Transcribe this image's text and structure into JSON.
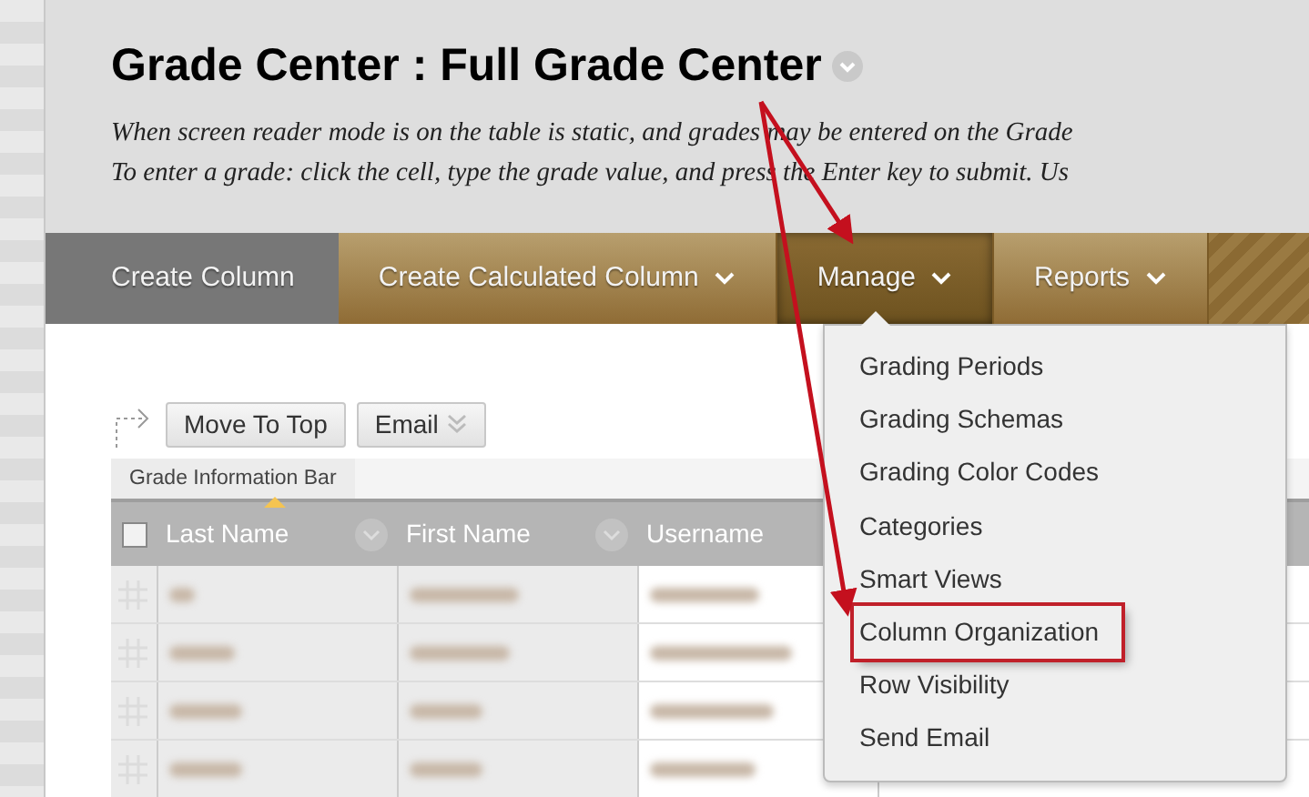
{
  "page_title": "Grade Center : Full Grade Center",
  "description": [
    "When screen reader mode is on the table is static, and grades may be entered on the Grade",
    "To enter a grade: click the cell, type the grade value, and press the Enter key to submit. Us"
  ],
  "nav": [
    {
      "label": "Create Column",
      "kind": "plain",
      "selected": false
    },
    {
      "label": "Create Calculated Column",
      "kind": "menu",
      "selected": false
    },
    {
      "label": "Manage",
      "kind": "menu",
      "selected": true
    },
    {
      "label": "Reports",
      "kind": "menu",
      "selected": false
    }
  ],
  "toolbar": {
    "buttons": [
      {
        "label": "Move To Top",
        "kind": "plain"
      },
      {
        "label": "Email",
        "kind": "menu"
      }
    ],
    "info_bar": "Grade Information Bar"
  },
  "table": {
    "select_all_checked": false,
    "columns": [
      {
        "label": "Last Name",
        "sorted": true
      },
      {
        "label": "First Name",
        "sorted": false
      },
      {
        "label": "Username",
        "sorted": false
      }
    ],
    "rows": [
      {
        "blurred": true
      },
      {
        "blurred": true
      },
      {
        "blurred": true
      },
      {
        "blurred": true
      }
    ]
  },
  "manage_menu": [
    {
      "label": "Grading Periods",
      "highlighted": false
    },
    {
      "label": "Grading Schemas",
      "highlighted": false
    },
    {
      "label": "Grading Color Codes",
      "highlighted": false
    },
    {
      "label": "Categories",
      "highlighted": false
    },
    {
      "label": "Smart Views",
      "highlighted": false
    },
    {
      "label": "Column Organization",
      "highlighted": true
    },
    {
      "label": "Row Visibility",
      "highlighted": false
    },
    {
      "label": "Send Email",
      "highlighted": false
    }
  ]
}
